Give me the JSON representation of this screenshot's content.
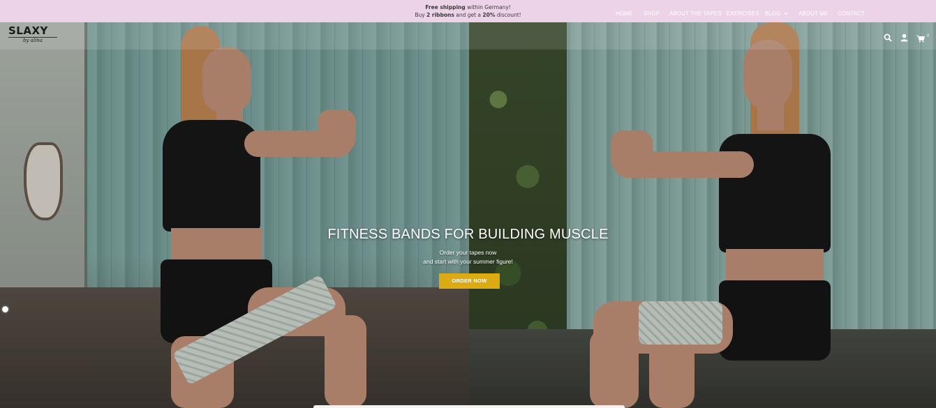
{
  "announcement": {
    "line1_bold": "Free shipping",
    "line1_rest": " within Germany!",
    "line2_pre": "Buy ",
    "line2_bold1": "2 ribbons",
    "line2_mid": " and get a ",
    "line2_bold2": "20%",
    "line2_post": " discount!"
  },
  "logo": {
    "word": "SLAXY",
    "sub": "by alina"
  },
  "nav": {
    "items": [
      "HOME",
      "SHOP",
      "ABOUT THE TAPES",
      "EXERCISES",
      "BLOG",
      "ABOUT ME",
      "CONTACT"
    ],
    "blog_dropdown_icon": "chevron-down-icon"
  },
  "header_icons": {
    "search": "search-icon",
    "account": "user-icon",
    "cart": "cart-icon",
    "cart_count": "0"
  },
  "hero": {
    "title": "FITNESS BANDS FOR BUILDING MUSCLE",
    "subtitle_line1": "Order your tapes now",
    "subtitle_line2": "and start with your summer figure!",
    "cta_label": "ORDER NOW",
    "cta_color": "#dcaa11"
  },
  "colors": {
    "announcement_bg": "#ecd3e7",
    "nav_text": "#ffffff"
  }
}
